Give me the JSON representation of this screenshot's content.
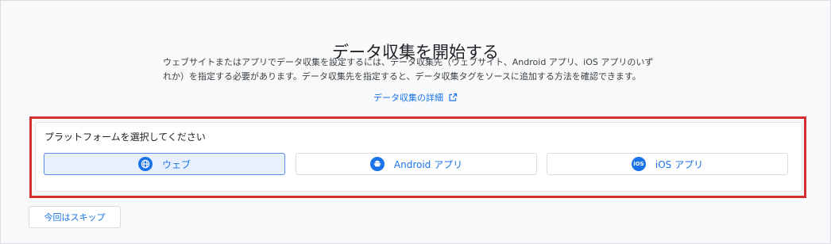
{
  "header": {
    "title": "データ収集を開始する",
    "description_line1": "ウェブサイトまたはアプリでデータ収集を設定するには、データ収集先（ウェブサイト、Android アプリ、iOS アプリのいず",
    "description_line2": "れか）を指定する必要があります。データ収集先を指定すると、データ収集タグをソースに追加する方法を確認できます。",
    "learn_more": "データ収集の詳細"
  },
  "platform_card": {
    "title": "プラットフォームを選択してください",
    "options": [
      {
        "label": "ウェブ",
        "icon": "globe-icon",
        "selected": true
      },
      {
        "label": "Android アプリ",
        "icon": "android-icon",
        "selected": false
      },
      {
        "label": "iOS アプリ",
        "icon": "ios-icon",
        "icon_text": "iOS",
        "selected": false
      }
    ]
  },
  "footer": {
    "skip_label": "今回はスキップ"
  },
  "colors": {
    "accent": "#1a73e8",
    "highlight": "#d32f2f",
    "selected_bg": "#e8f0fe"
  }
}
